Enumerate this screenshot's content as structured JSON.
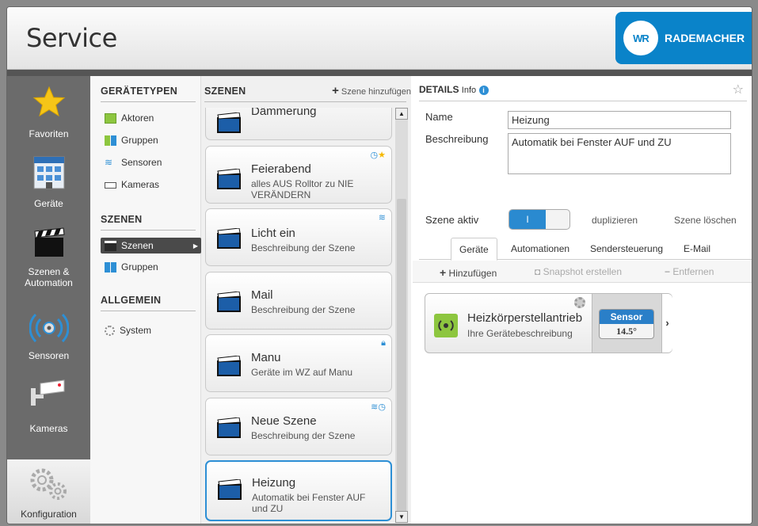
{
  "app": {
    "title": "Service",
    "brand_logo_text": "WR",
    "brand_name": "RADEMACHER"
  },
  "nav": {
    "items": [
      {
        "label": "Favoriten",
        "icon": "star-icon"
      },
      {
        "label": "Geräte",
        "icon": "building-icon"
      },
      {
        "label": "Szenen &",
        "label2": "Automation",
        "icon": "clapperboard-icon"
      },
      {
        "label": "Sensoren",
        "icon": "sensor-icon"
      },
      {
        "label": "Kameras",
        "icon": "camera-icon"
      }
    ],
    "config_label": "Konfiguration"
  },
  "types": {
    "section_geraetetypen": "GERÄTETYPEN",
    "geraetetypen": [
      "Aktoren",
      "Gruppen",
      "Sensoren",
      "Kameras"
    ],
    "section_szenen": "SZENEN",
    "szenen": [
      "Szenen",
      "Gruppen"
    ],
    "section_allgemein": "ALLGEMEIN",
    "allgemein": [
      "System"
    ]
  },
  "scenes": {
    "header": "SZENEN",
    "add_label": "Szene hinzufügen",
    "list": [
      {
        "title": "Dämmerung",
        "desc": ""
      },
      {
        "title": "Feierabend",
        "desc": "alles AUS Rolltor zu NIE VERÄNDERN",
        "flags": "◷★"
      },
      {
        "title": "Licht ein",
        "desc": "Beschreibung der Szene",
        "flags": "wifi"
      },
      {
        "title": "Mail",
        "desc": "Beschreibung der Szene",
        "flags": ""
      },
      {
        "title": "Manu",
        "desc": "Geräte im WZ auf Manu",
        "flags": "lock"
      },
      {
        "title": "Neue Szene",
        "desc": "Beschreibung der Szene",
        "flags": "wifi◷"
      },
      {
        "title": "Heizung",
        "desc": "Automatik bei Fenster AUF und ZU",
        "flags": ""
      }
    ]
  },
  "details": {
    "header": "DETAILS",
    "info_label": "Info",
    "name_label": "Name",
    "name_value": "Heizung",
    "desc_label": "Beschreibung",
    "desc_value": "Automatik bei Fenster AUF und ZU",
    "active_label": "Szene aktiv",
    "toggle_on": "I",
    "duplicate_label": "duplizieren",
    "delete_label": "Szene löschen",
    "tabs": [
      "Geräte",
      "Automationen",
      "Sendersteuerung",
      "E-Mail"
    ],
    "toolbar": {
      "add": "Hinzufügen",
      "snapshot": "Snapshot erstellen",
      "remove": "Entfernen"
    },
    "device": {
      "name": "Heizkörperstellantrieb",
      "desc": "Ihre Gerätebeschreibung",
      "badge_label": "Sensor",
      "badge_value": "14.5°"
    }
  },
  "colors": {
    "accent": "#2d8fd5",
    "brand": "#0a83c9",
    "sidebar": "#6b6b6b"
  }
}
